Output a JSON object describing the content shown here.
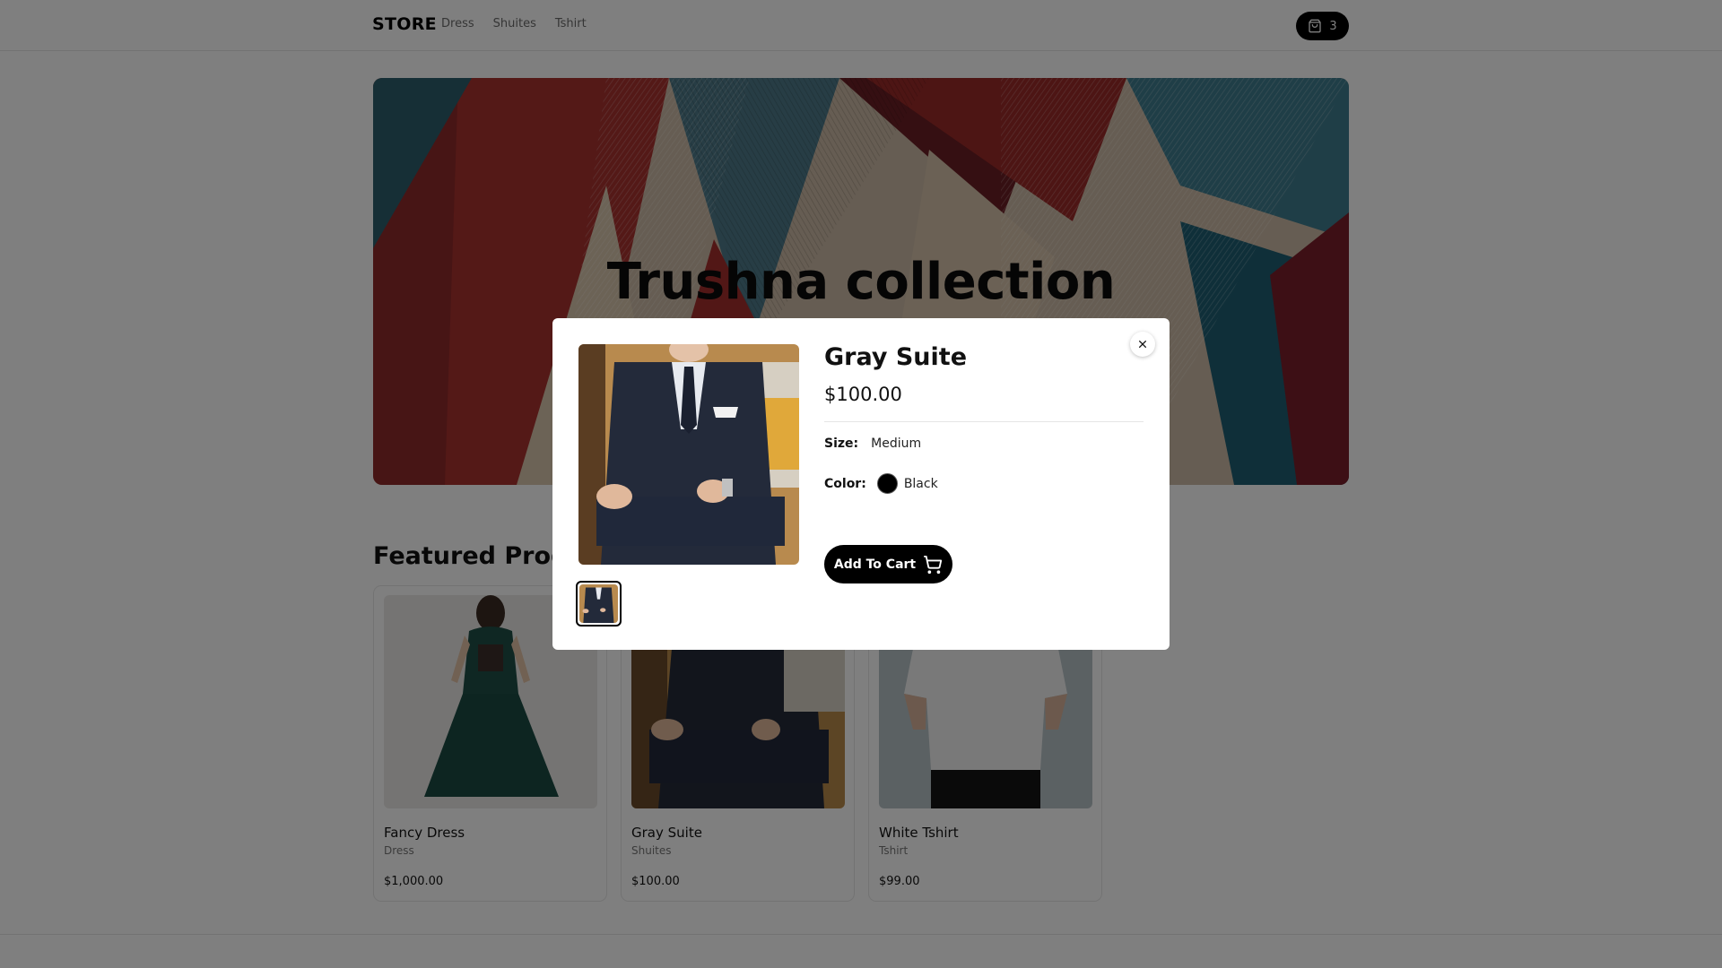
{
  "header": {
    "logo": "STORE",
    "nav": [
      "Dress",
      "Shuites",
      "Tshirt"
    ],
    "cart_count": "3"
  },
  "hero": {
    "title": "Trushna collection"
  },
  "featured": {
    "title": "Featured Products",
    "products": [
      {
        "name": "Fancy Dress",
        "category": "Dress",
        "price": "$1,000.00"
      },
      {
        "name": "Gray Suite",
        "category": "Shuites",
        "price": "$100.00"
      },
      {
        "name": "White Tshirt",
        "category": "Tshirt",
        "price": "$99.00"
      }
    ]
  },
  "modal": {
    "title": "Gray Suite",
    "price": "$100.00",
    "size_label": "Size:",
    "size_value": "Medium",
    "color_label": "Color:",
    "color_value": "Black",
    "color_hex": "#000000",
    "add_to_cart": "Add To Cart"
  },
  "icons": {
    "cart": "shopping-bag-icon",
    "close": "close-icon",
    "add_cart": "cart-icon"
  }
}
